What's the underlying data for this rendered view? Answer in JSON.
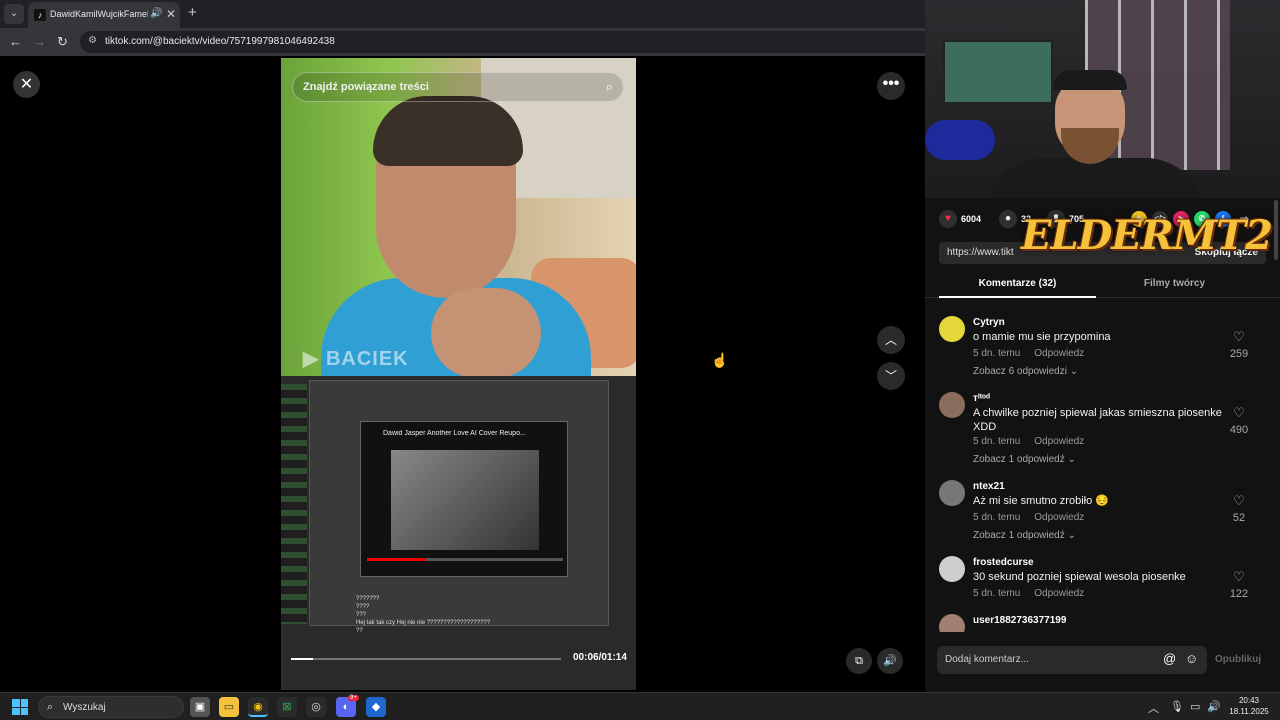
{
  "browser": {
    "tab_title": "DawidKamilWujcikFameMma",
    "url": "tiktok.com/@baciektv/video/7571997981046492438"
  },
  "video": {
    "search_placeholder": "Znajdź powiązane treści",
    "watermark": "BACIEK",
    "time": "00:06/01:14",
    "progress": 0.08,
    "embedded_title": "Dawid Jasper Another Love AI Cover Reupo...",
    "embedded_chat": [
      "???????",
      "????",
      "???",
      "Hej tak tak czy Hej nie nie ???????????????????",
      "??"
    ]
  },
  "stats": {
    "likes": "6004",
    "comments": "32",
    "saves": "705"
  },
  "link": {
    "url": "https://www.tikt",
    "copy_label": "Skopiuj łącze"
  },
  "overlay_logo": "ELDERMT2",
  "tabs": {
    "comments": "Komentarze (32)",
    "creator": "Filmy twórcy"
  },
  "comments": [
    {
      "user": "Cytryn",
      "text": "o mamie mu sie przypomina",
      "time": "5 dn. temu",
      "reply": "Odpowiedz",
      "replies": "Zobacz 6 odpowiedzi",
      "likes": "259",
      "avatar_color": "#e4d83a"
    },
    {
      "user": "ᴛᴵᵗᵒᵈ",
      "text": "A chwilke pozniej spiewal jakas smieszna piosenke XDD",
      "time": "5 dn. temu",
      "reply": "Odpowiedz",
      "replies": "Zobacz 1 odpowiedź",
      "likes": "490",
      "avatar_color": "#8a6d5c"
    },
    {
      "user": "ntex21",
      "text": "Aż mi sie smutno zrobiło 😔",
      "time": "5 dn. temu",
      "reply": "Odpowiedz",
      "replies": "Zobacz 1 odpowiedź",
      "likes": "52",
      "avatar_color": "#777777"
    },
    {
      "user": "frostedcurse",
      "text": "30 sekund pozniej spiewal wesola piosenke",
      "time": "5 dn. temu",
      "reply": "Odpowiedz",
      "replies": "",
      "likes": "122",
      "avatar_color": "#cfcfcf"
    },
    {
      "user": "user1882736377199",
      "text": "",
      "time": "",
      "reply": "",
      "replies": "",
      "likes": "",
      "avatar_color": "#a08070"
    }
  ],
  "composer": {
    "placeholder": "Dodaj komentarz...",
    "publish": "Opublikuj"
  },
  "taskbar": {
    "search": "Wyszukaj",
    "discord_badge": "9+",
    "time": "20:43",
    "date": "18.11.2025"
  }
}
